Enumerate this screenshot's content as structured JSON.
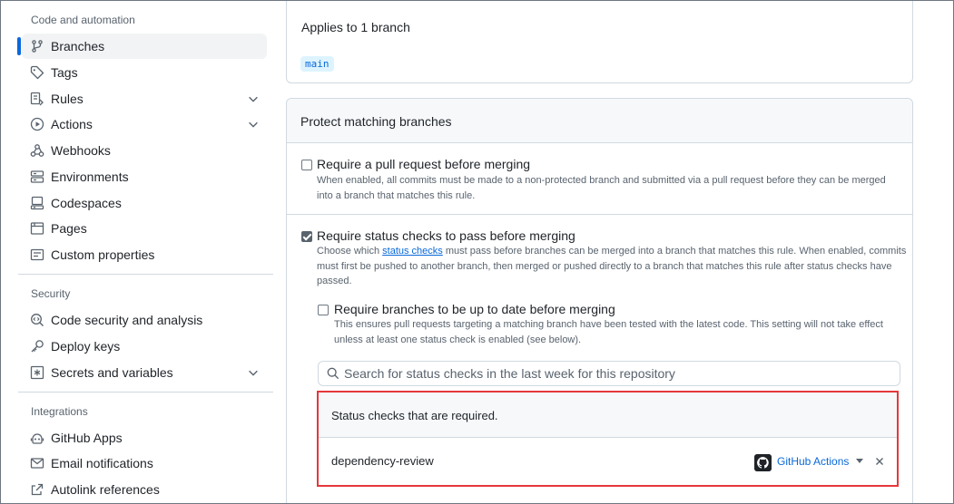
{
  "sidebar": {
    "sections": [
      {
        "title": "Code and automation"
      },
      {
        "title": "Security"
      },
      {
        "title": "Integrations"
      }
    ],
    "items": [
      {
        "label": "Branches"
      },
      {
        "label": "Tags"
      },
      {
        "label": "Rules"
      },
      {
        "label": "Actions"
      },
      {
        "label": "Webhooks"
      },
      {
        "label": "Environments"
      },
      {
        "label": "Codespaces"
      },
      {
        "label": "Pages"
      },
      {
        "label": "Custom properties"
      },
      {
        "label": "Code security and analysis"
      },
      {
        "label": "Deploy keys"
      },
      {
        "label": "Secrets and variables"
      },
      {
        "label": "GitHub Apps"
      },
      {
        "label": "Email notifications"
      },
      {
        "label": "Autolink references"
      }
    ],
    "active_item": "Branches"
  },
  "applies": {
    "title": "Applies to 1 branch",
    "branch": "main"
  },
  "protect": {
    "header": "Protect matching branches",
    "pull_request": {
      "label": "Require a pull request before merging",
      "description": "When enabled, all commits must be made to a non-protected branch and submitted via a pull request before they can be merged into a branch that matches this rule.",
      "checked": false
    },
    "status_checks": {
      "label": "Require status checks to pass before merging",
      "desc_before": "Choose which ",
      "desc_link": "status checks",
      "desc_after": " must pass before branches can be merged into a branch that matches this rule. When enabled, commits must first be pushed to another branch, then merged or pushed directly to a branch that matches this rule after status checks have passed.",
      "checked": true
    },
    "up_to_date": {
      "label": "Require branches to be up to date before merging",
      "description": "This ensures pull requests targeting a matching branch have been tested with the latest code. This setting will not take effect unless at least one status check is enabled (see below).",
      "checked": false
    },
    "search": {
      "placeholder": "Search for status checks in the last week for this repository",
      "value": ""
    },
    "required": {
      "header": "Status checks that are required.",
      "checks": [
        {
          "name": "dependency-review",
          "source": "GitHub Actions"
        }
      ]
    }
  },
  "colors": {
    "accent": "#0969da",
    "highlight_border": "#e5383b",
    "header_bg": "#f6f8fa"
  }
}
